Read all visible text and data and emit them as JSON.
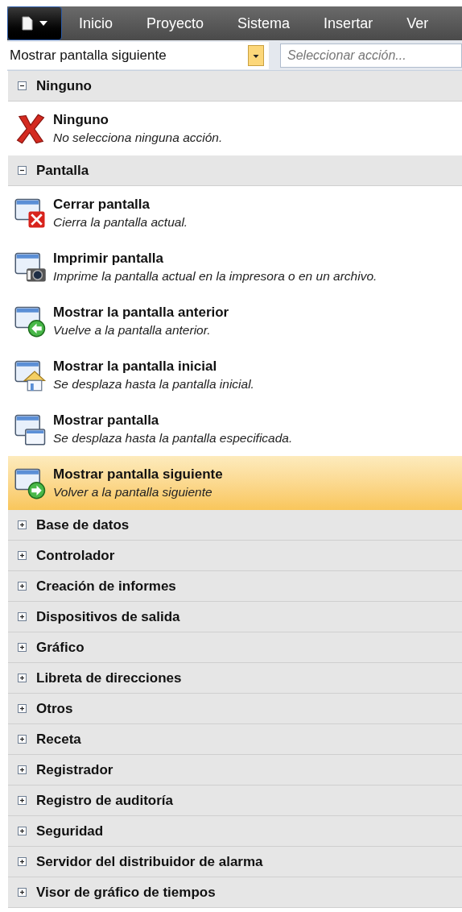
{
  "menu_bar": {
    "tabs": [
      {
        "label": "Inicio",
        "selected": false
      },
      {
        "label": "Proyecto",
        "selected": false
      },
      {
        "label": "Sistema",
        "selected": false
      },
      {
        "label": "Insertar",
        "selected": false
      },
      {
        "label": "Ver",
        "selected": false
      }
    ]
  },
  "action_combo": {
    "value": "Mostrar pantalla siguiente"
  },
  "search": {
    "placeholder": "Seleccionar acción..."
  },
  "groups": [
    {
      "label": "Ninguno",
      "expanded": true,
      "items": [
        {
          "kind": "none",
          "title": "Ninguno",
          "description": "No selecciona ninguna acción.",
          "selected": false
        }
      ]
    },
    {
      "label": "Pantalla",
      "expanded": true,
      "items": [
        {
          "kind": "close",
          "title": "Cerrar pantalla",
          "description": "Cierra la pantalla actual.",
          "selected": false
        },
        {
          "kind": "print",
          "title": "Imprimir pantalla",
          "description": "Imprime la pantalla actual en la impresora o en un archivo.",
          "selected": false
        },
        {
          "kind": "back",
          "title": "Mostrar la pantalla anterior",
          "description": "Vuelve a la pantalla anterior.",
          "selected": false
        },
        {
          "kind": "home",
          "title": "Mostrar la pantalla inicial",
          "description": "Se desplaza hasta la pantalla inicial.",
          "selected": false
        },
        {
          "kind": "show",
          "title": "Mostrar pantalla",
          "description": "Se desplaza hasta la pantalla especificada.",
          "selected": false
        },
        {
          "kind": "next",
          "title": "Mostrar pantalla siguiente",
          "description": "Volver a la pantalla siguiente",
          "selected": true
        }
      ]
    },
    {
      "label": "Base de datos",
      "expanded": false
    },
    {
      "label": "Controlador",
      "expanded": false
    },
    {
      "label": "Creación de informes",
      "expanded": false
    },
    {
      "label": "Dispositivos de salida",
      "expanded": false
    },
    {
      "label": "Gráfico",
      "expanded": false
    },
    {
      "label": "Libreta de direcciones",
      "expanded": false
    },
    {
      "label": "Otros",
      "expanded": false
    },
    {
      "label": "Receta",
      "expanded": false
    },
    {
      "label": "Registrador",
      "expanded": false
    },
    {
      "label": "Registro de auditoría",
      "expanded": false
    },
    {
      "label": "Seguridad",
      "expanded": false
    },
    {
      "label": "Servidor del distribuidor de alarma",
      "expanded": false
    },
    {
      "label": "Visor de gráfico de tiempos",
      "expanded": false
    }
  ]
}
